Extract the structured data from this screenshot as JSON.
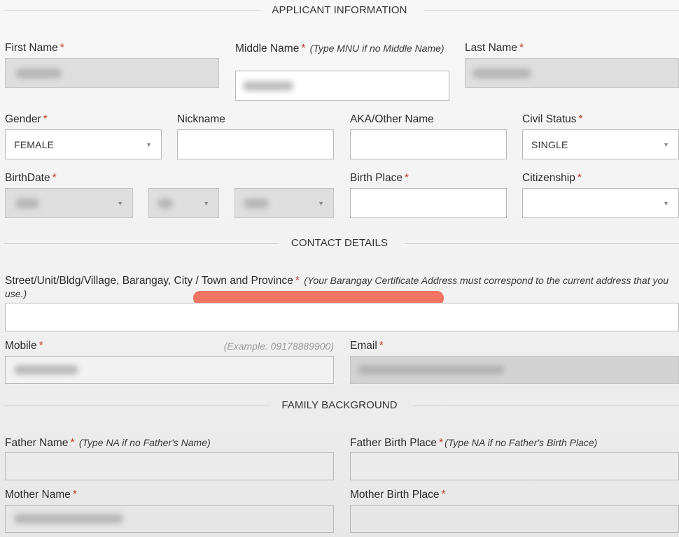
{
  "applicant_section": {
    "heading": "APPLICANT INFORMATION",
    "first_name": {
      "label": "First Name",
      "required": "*"
    },
    "middle_name": {
      "label": "Middle Name",
      "required": "*",
      "note": "(Type MNU if no Middle Name)"
    },
    "last_name": {
      "label": "Last Name",
      "required": "*"
    },
    "gender": {
      "label": "Gender",
      "required": "*",
      "value": "FEMALE"
    },
    "nickname": {
      "label": "Nickname"
    },
    "aka": {
      "label": "AKA/Other Name"
    },
    "civil_status": {
      "label": "Civil Status",
      "required": "*",
      "value": "SINGLE"
    },
    "birthdate": {
      "label": "BirthDate",
      "required": "*"
    },
    "birth_place": {
      "label": "Birth Place",
      "required": "*"
    },
    "citizenship": {
      "label": "Citizenship",
      "required": "*"
    }
  },
  "contact_section": {
    "heading": "CONTACT DETAILS",
    "address": {
      "label": "Street/Unit/Bldg/Village, Barangay, City / Town and Province",
      "required": "*",
      "note": "(Your Barangay Certificate Address must correspond to the current address that you use.)"
    },
    "mobile": {
      "label": "Mobile",
      "required": "*",
      "hint": "(Example: 09178889900)"
    },
    "email": {
      "label": "Email",
      "required": "*"
    }
  },
  "family_section": {
    "heading": "FAMILY BACKGROUND",
    "father_name": {
      "label": "Father Name",
      "required": "*",
      "note": "(Type NA if no Father's Name)"
    },
    "father_birth_place": {
      "label": "Father Birth Place",
      "required": "*",
      "note": "(Type NA if no Father's Birth Place)"
    },
    "mother_name": {
      "label": "Mother Name",
      "required": "*"
    },
    "mother_birth_place": {
      "label": "Mother Birth Place",
      "required": "*"
    }
  },
  "icons": {
    "select_caret": "caret-down-icon"
  },
  "colors": {
    "required_marker": "#c0392b",
    "redaction": "#f07563",
    "disabled_field": "#dedede"
  }
}
